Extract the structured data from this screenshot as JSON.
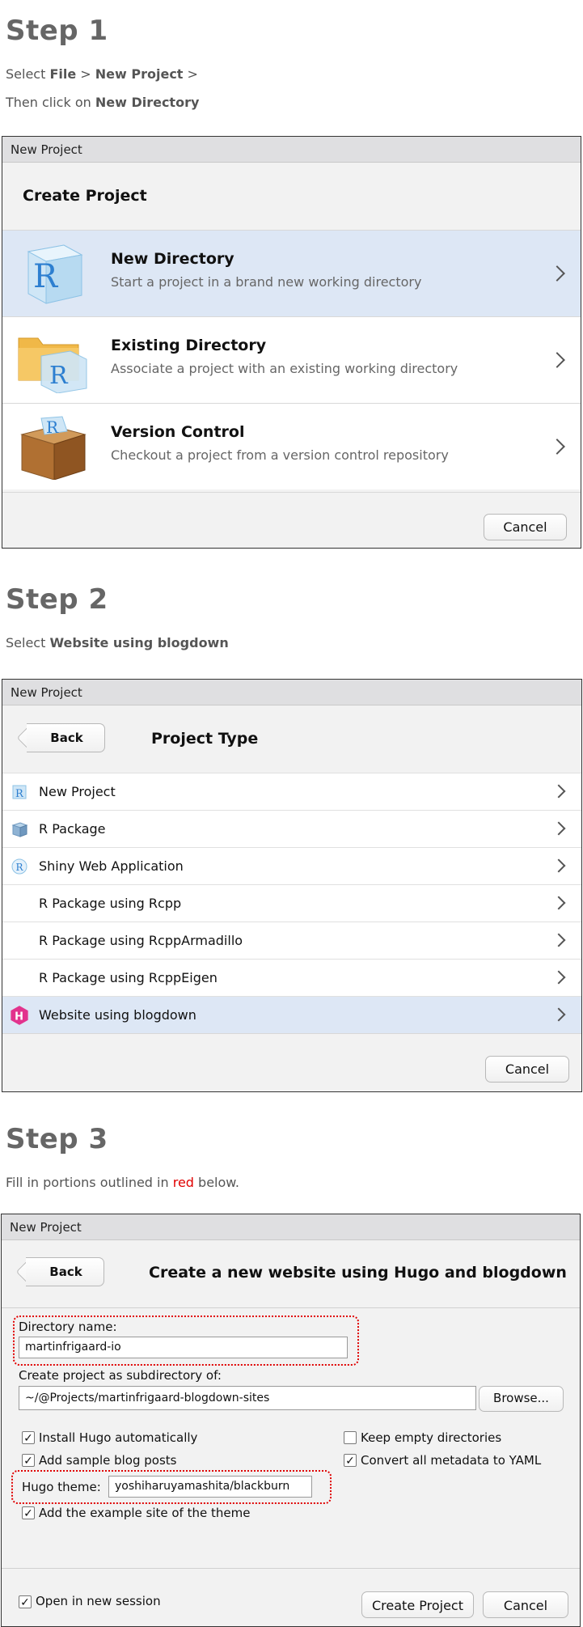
{
  "step1": {
    "title": "Step 1",
    "line1": {
      "pre": "Select ",
      "b1": "File",
      "mid": " > ",
      "b2": "New Project",
      "post": " >"
    },
    "line2": {
      "pre": "Then click on ",
      "b": "New Directory"
    },
    "window": {
      "titlebar": "New Project",
      "heading": "Create Project",
      "options": [
        {
          "icon": "r-cube-icon",
          "title": "New Directory",
          "desc": "Start a project in a brand new working directory",
          "selected": true
        },
        {
          "icon": "folder-r-cube-icon",
          "title": "Existing Directory",
          "desc": "Associate a project with an existing working directory",
          "selected": false
        },
        {
          "icon": "box-icon",
          "title": "Version Control",
          "desc": "Checkout a project from a version control repository",
          "selected": false
        }
      ],
      "cancel": "Cancel"
    }
  },
  "step2": {
    "title": "Step 2",
    "line1": {
      "pre": "Select ",
      "b": "Website using blogdown"
    },
    "window": {
      "titlebar": "New Project",
      "back": "Back",
      "heading": "Project Type",
      "rows": [
        {
          "label": "New Project",
          "icon": "r-cube-small-icon"
        },
        {
          "label": "R Package",
          "icon": "package-icon"
        },
        {
          "label": "Shiny Web Application",
          "icon": "r-circle-icon"
        },
        {
          "label": "R Package using Rcpp",
          "icon": ""
        },
        {
          "label": "R Package using RcppArmadillo",
          "icon": ""
        },
        {
          "label": "R Package using RcppEigen",
          "icon": ""
        },
        {
          "label": "Website using blogdown",
          "icon": "hugo-hex-icon",
          "selected": true
        }
      ],
      "cancel": "Cancel"
    }
  },
  "step3": {
    "title": "Step 3",
    "line1": {
      "pre": "Fill in portions outlined in ",
      "red": "red",
      "post": " below."
    },
    "window": {
      "titlebar": "New Project",
      "back": "Back",
      "heading": "Create a new website using Hugo and blogdown",
      "dir_label": "Directory name:",
      "dir_value": "martinfrigaard-io",
      "sub_label": "Create project as subdirectory of:",
      "sub_value": "~/@Projects/martinfrigaard-blogdown-sites",
      "browse": "Browse...",
      "checks": {
        "install_hugo": {
          "label": "Install Hugo automatically",
          "checked": true
        },
        "sample_posts": {
          "label": "Add sample blog posts",
          "checked": true
        },
        "keep_empty": {
          "label": "Keep empty directories",
          "checked": false
        },
        "convert_yaml": {
          "label": "Convert all metadata to YAML",
          "checked": true
        },
        "example_site": {
          "label": "Add the example site of the theme",
          "checked": true
        },
        "new_session": {
          "label": "Open in new session",
          "checked": true
        }
      },
      "theme_label": "Hugo theme:",
      "theme_value": "yoshiharuyamashita/blackburn",
      "create": "Create Project",
      "cancel": "Cancel"
    }
  },
  "colors": {
    "selected_row": "#dde7f5",
    "outline_red": "#e00000",
    "hugo_pink": "#e2338d",
    "r_blue": "#2d7fd0"
  }
}
